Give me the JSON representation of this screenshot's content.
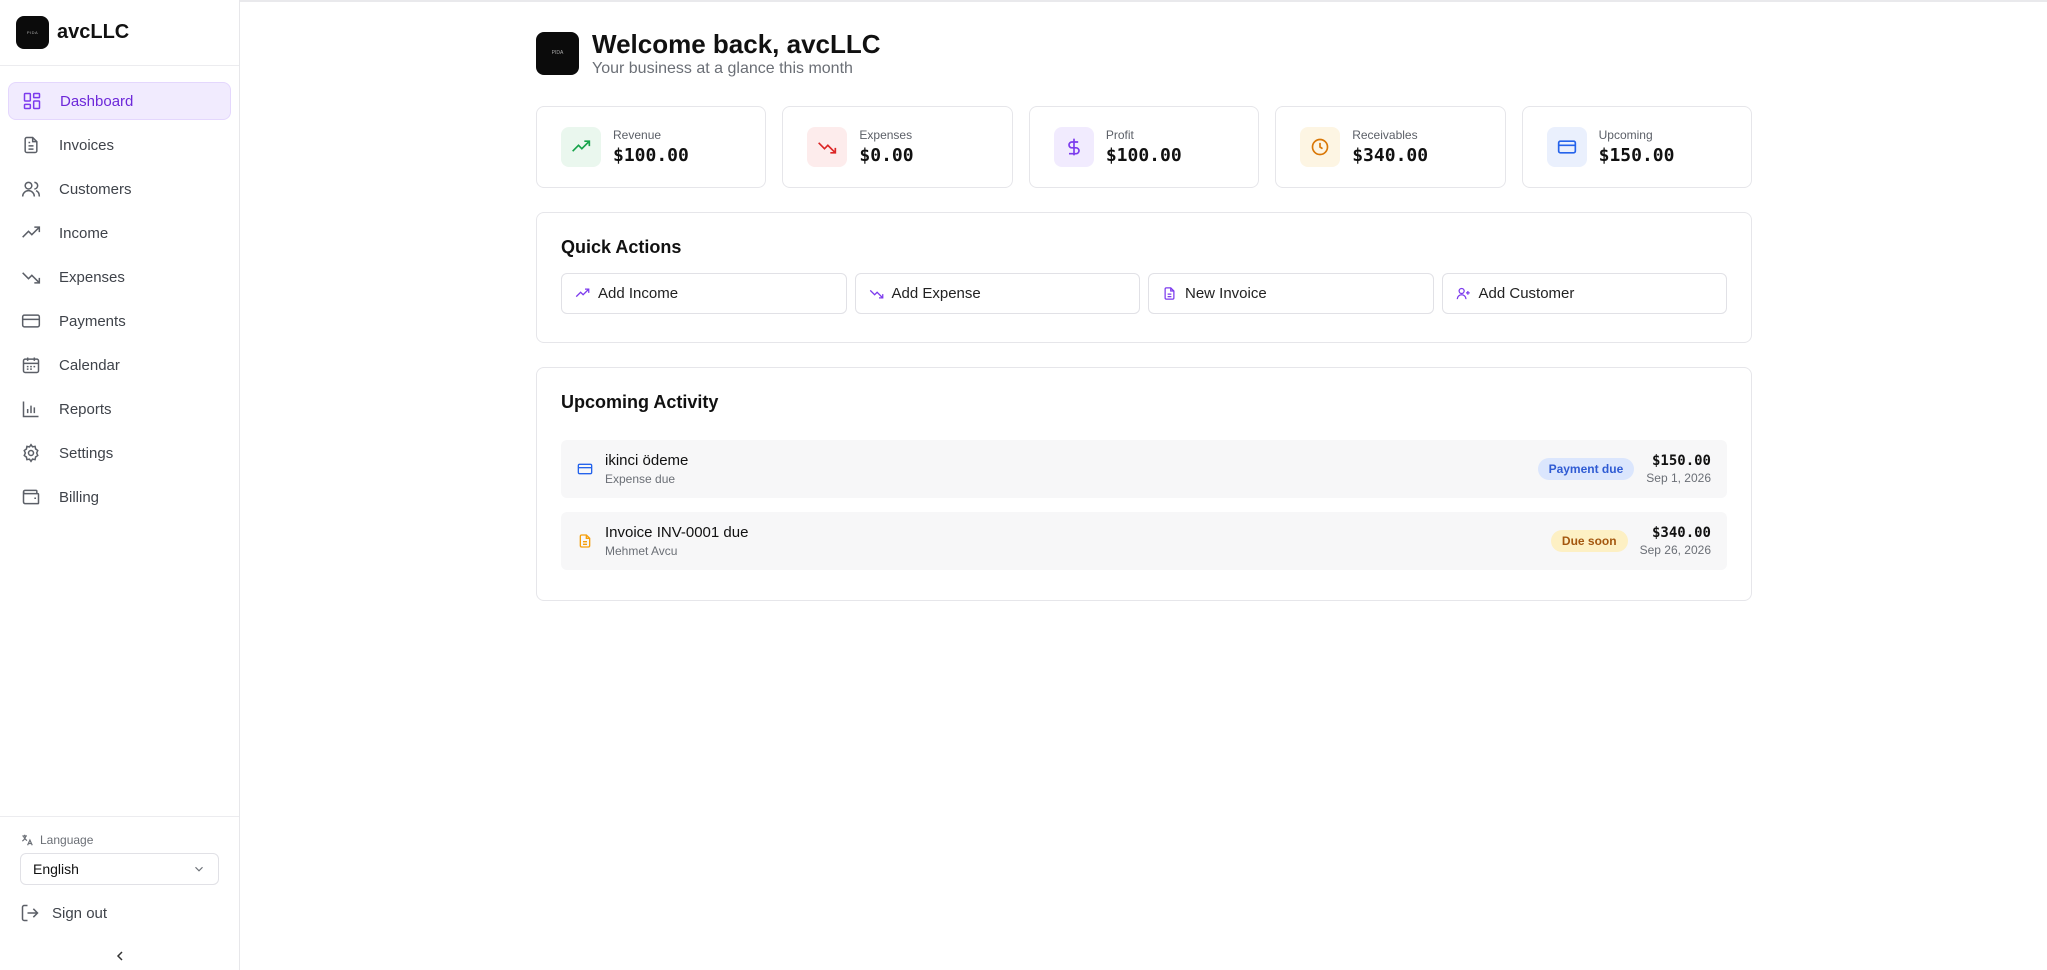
{
  "brand": {
    "name": "avcLLC",
    "logo_text": "PIDA"
  },
  "sidebar": {
    "items": [
      {
        "label": "Dashboard",
        "icon": "dashboard-grid-icon",
        "active": true
      },
      {
        "label": "Invoices",
        "icon": "document-icon"
      },
      {
        "label": "Customers",
        "icon": "users-icon"
      },
      {
        "label": "Income",
        "icon": "trending-up-icon"
      },
      {
        "label": "Expenses",
        "icon": "trending-down-icon"
      },
      {
        "label": "Payments",
        "icon": "credit-card-icon"
      },
      {
        "label": "Calendar",
        "icon": "calendar-icon"
      },
      {
        "label": "Reports",
        "icon": "bar-chart-icon"
      },
      {
        "label": "Settings",
        "icon": "gear-icon"
      },
      {
        "label": "Billing",
        "icon": "wallet-icon"
      }
    ],
    "language_label": "Language",
    "language_value": "English",
    "signout_label": "Sign out"
  },
  "header": {
    "title": "Welcome back, avcLLC",
    "subtitle": "Your business at a glance this month"
  },
  "stats": [
    {
      "label": "Revenue",
      "value": "$100.00",
      "icon": "trending-up-icon",
      "color": "#16a34a",
      "bg": "#eaf7ee"
    },
    {
      "label": "Expenses",
      "value": "$0.00",
      "icon": "trending-down-icon",
      "color": "#dc2626",
      "bg": "#fdecec"
    },
    {
      "label": "Profit",
      "value": "$100.00",
      "icon": "dollar-icon",
      "color": "#7c3aed",
      "bg": "#f1ebfe"
    },
    {
      "label": "Receivables",
      "value": "$340.00",
      "icon": "clock-icon",
      "color": "#d97706",
      "bg": "#fdf5e3"
    },
    {
      "label": "Upcoming",
      "value": "$150.00",
      "icon": "credit-card-icon",
      "color": "#2563eb",
      "bg": "#eaf0fd"
    }
  ],
  "quick_actions": {
    "title": "Quick Actions",
    "buttons": [
      {
        "label": "Add Income",
        "icon": "trending-up-icon"
      },
      {
        "label": "Add Expense",
        "icon": "trending-down-icon"
      },
      {
        "label": "New Invoice",
        "icon": "document-icon"
      },
      {
        "label": "Add Customer",
        "icon": "user-plus-icon"
      }
    ]
  },
  "activity": {
    "title": "Upcoming Activity",
    "items": [
      {
        "title": "ikinci ödeme",
        "subtitle": "Expense due",
        "badge": "Payment due",
        "amount": "$150.00",
        "date": "Sep 1, 2026",
        "icon": "credit-card-icon",
        "icon_color": "#2563eb"
      },
      {
        "title": "Invoice INV-0001 due",
        "subtitle": "Mehmet Avcu",
        "badge": "Due soon",
        "amount": "$340.00",
        "date": "Sep 26, 2026",
        "icon": "document-icon",
        "icon_color": "#f59e0b"
      }
    ]
  }
}
